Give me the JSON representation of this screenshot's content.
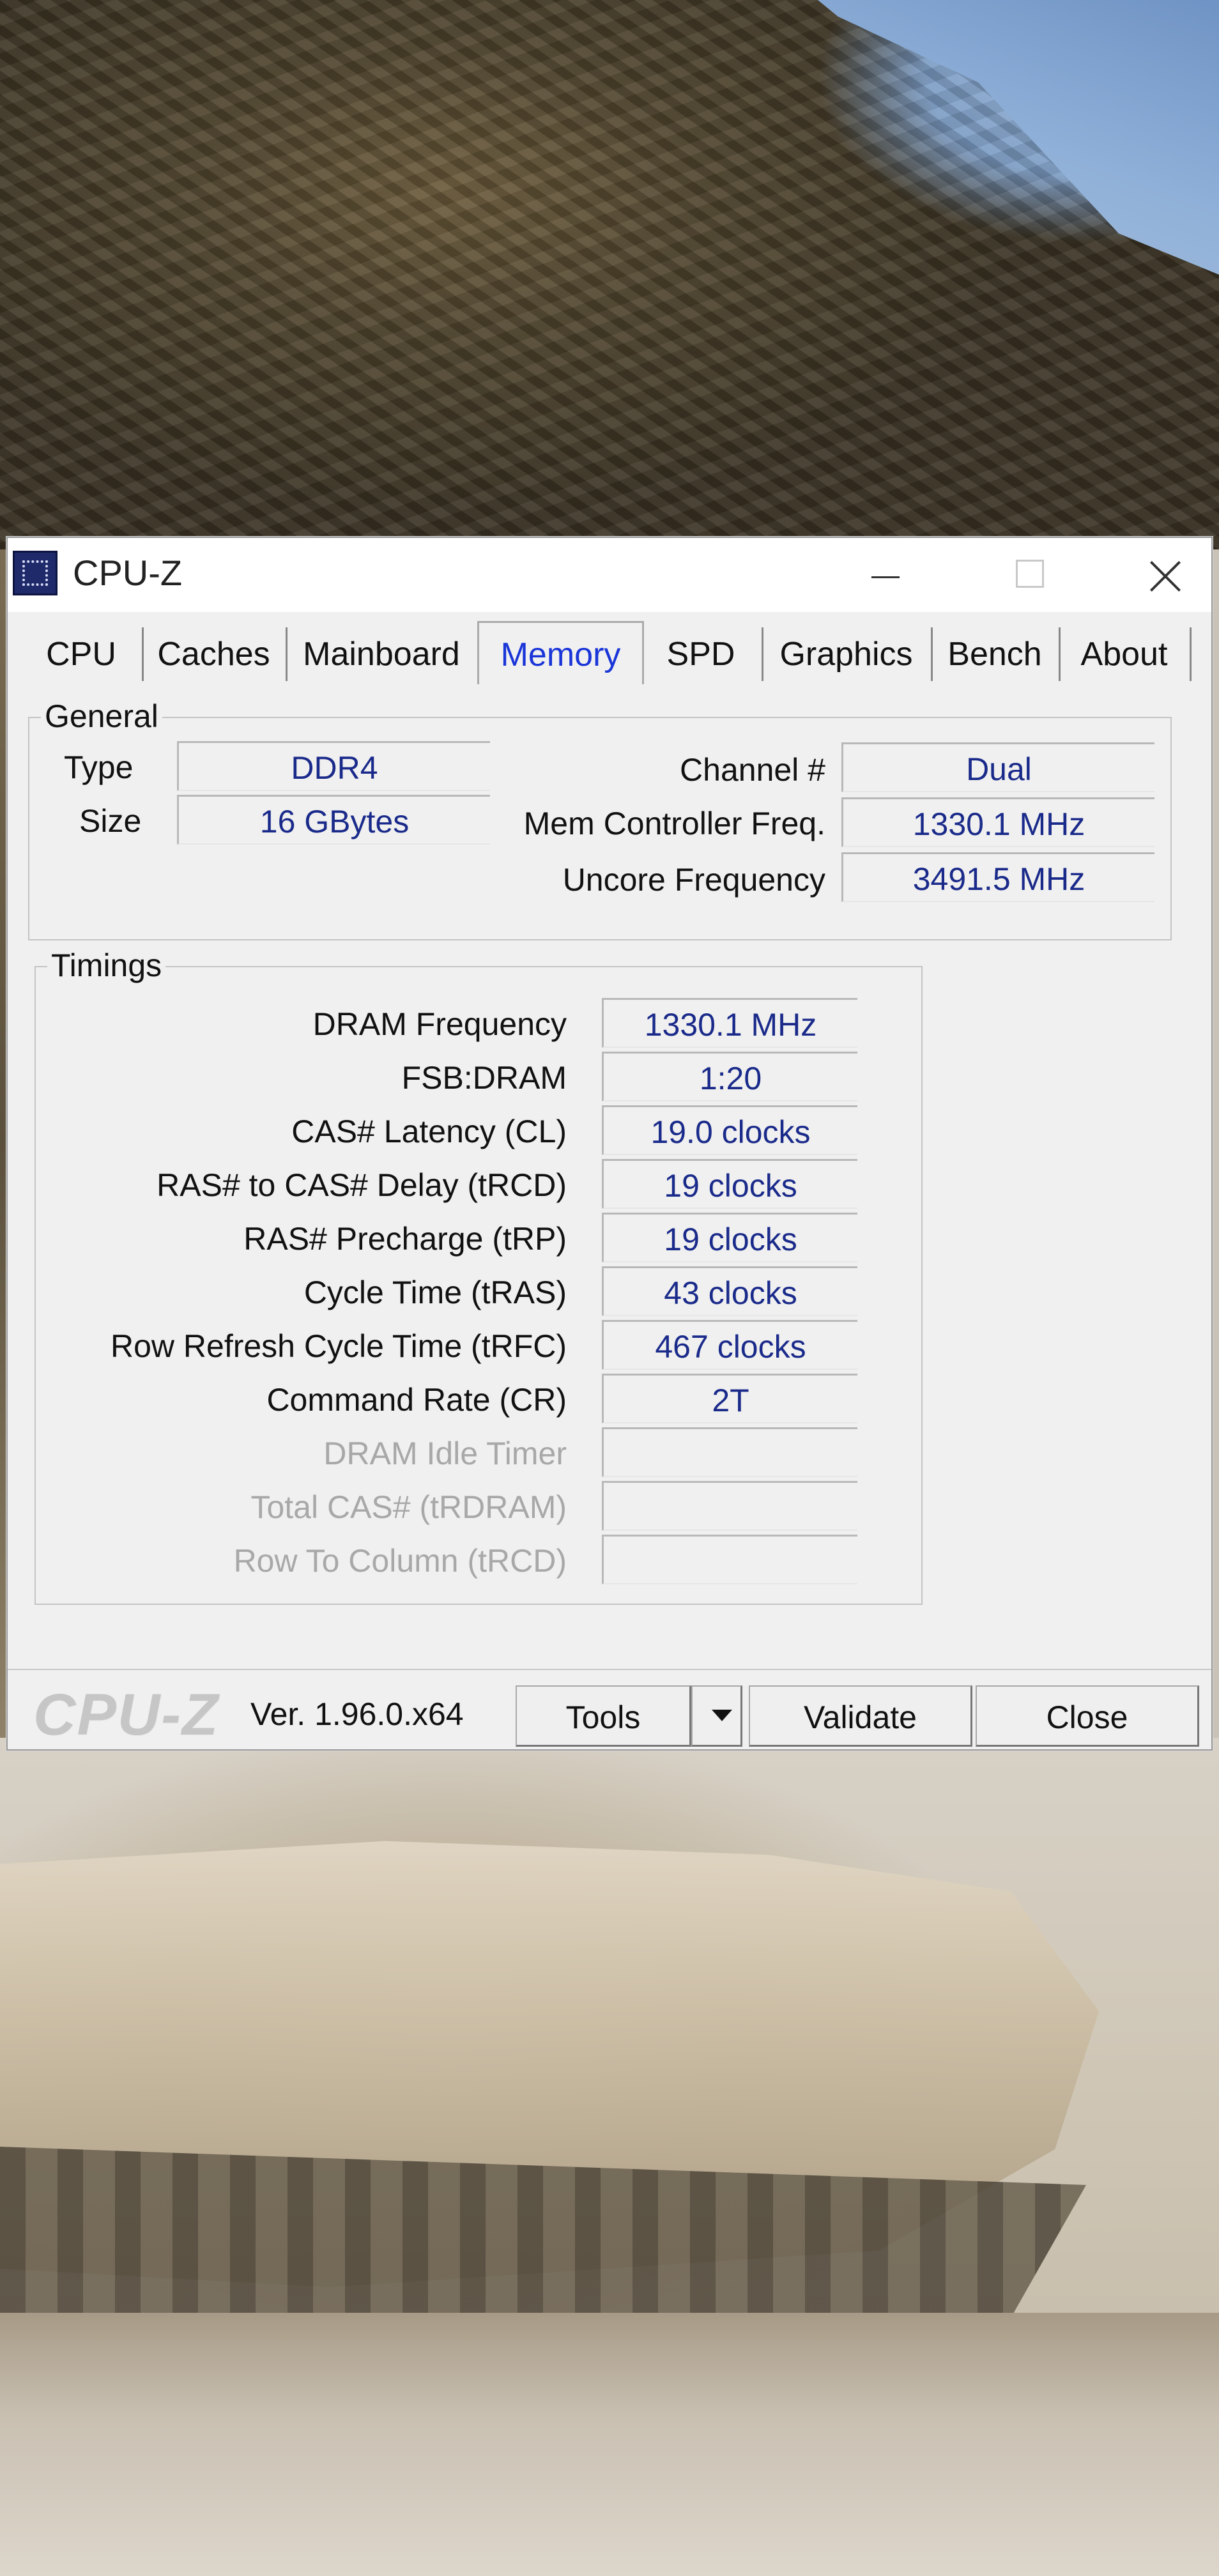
{
  "window": {
    "title": "CPU-Z"
  },
  "tabs": [
    {
      "label": "CPU"
    },
    {
      "label": "Caches"
    },
    {
      "label": "Mainboard"
    },
    {
      "label": "Memory",
      "active": true
    },
    {
      "label": "SPD"
    },
    {
      "label": "Graphics"
    },
    {
      "label": "Bench"
    },
    {
      "label": "About"
    }
  ],
  "general": {
    "title": "General",
    "type_label": "Type",
    "type_value": "DDR4",
    "size_label": "Size",
    "size_value": "16 GBytes",
    "channel_label": "Channel #",
    "channel_value": "Dual",
    "mcf_label": "Mem Controller Freq.",
    "mcf_value": "1330.1 MHz",
    "uncore_label": "Uncore Frequency",
    "uncore_value": "3491.5 MHz"
  },
  "timings": {
    "title": "Timings",
    "rows": [
      {
        "label": "DRAM Frequency",
        "value": "1330.1 MHz"
      },
      {
        "label": "FSB:DRAM",
        "value": "1:20"
      },
      {
        "label": "CAS# Latency (CL)",
        "value": "19.0 clocks"
      },
      {
        "label": "RAS# to CAS# Delay (tRCD)",
        "value": "19 clocks"
      },
      {
        "label": "RAS# Precharge (tRP)",
        "value": "19 clocks"
      },
      {
        "label": "Cycle Time (tRAS)",
        "value": "43 clocks"
      },
      {
        "label": "Row Refresh Cycle Time (tRFC)",
        "value": "467 clocks"
      },
      {
        "label": "Command Rate (CR)",
        "value": "2T"
      },
      {
        "label": "DRAM Idle Timer",
        "value": "",
        "disabled": true
      },
      {
        "label": "Total CAS# (tRDRAM)",
        "value": "",
        "disabled": true
      },
      {
        "label": "Row To Column (tRCD)",
        "value": "",
        "disabled": true
      }
    ]
  },
  "footer": {
    "logo": "CPU-Z",
    "version": "Ver. 1.96.0.x64",
    "tools_label": "Tools",
    "validate_label": "Validate",
    "close_label": "Close"
  }
}
